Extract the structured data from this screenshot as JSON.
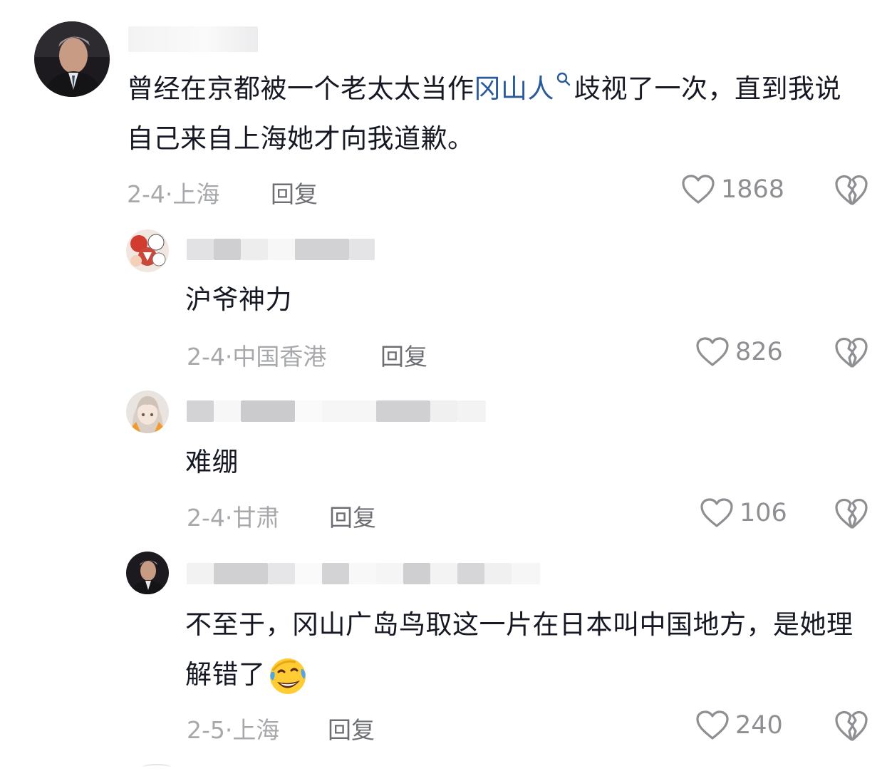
{
  "colors": {
    "text": "#161823",
    "meta": "#a7a8ab",
    "reply": "#6e6f74",
    "like": "#8e8f93",
    "keyword": "#2a5a9c"
  },
  "comments": [
    {
      "text_before": "曾经在京都被一个老太太当作",
      "keyword": "冈山人",
      "text_after": "歧视了一次，直到我说自己来自上海她才向我道歉。",
      "date": "2-4·上海",
      "reply_label": "回复",
      "likes": "1868",
      "avatar_icon": "man-in-suit-avatar"
    },
    {
      "text": "沪爷神力",
      "date": "2-4·中国香港",
      "reply_label": "回复",
      "likes": "826",
      "avatar_icon": "anime-collage-avatar"
    },
    {
      "text": "难绷",
      "date": "2-4·甘肃",
      "reply_label": "回复",
      "likes": "106",
      "avatar_icon": "anime-girl-avatar"
    },
    {
      "text": "不至于，冈山广岛鸟取这一片在日本叫中国地方，是她理解错了",
      "date": "2-5·上海",
      "reply_label": "回复",
      "likes": "240",
      "avatar_icon": "man-in-suit-avatar",
      "emoji": "rolling-laughing-emoji"
    }
  ]
}
